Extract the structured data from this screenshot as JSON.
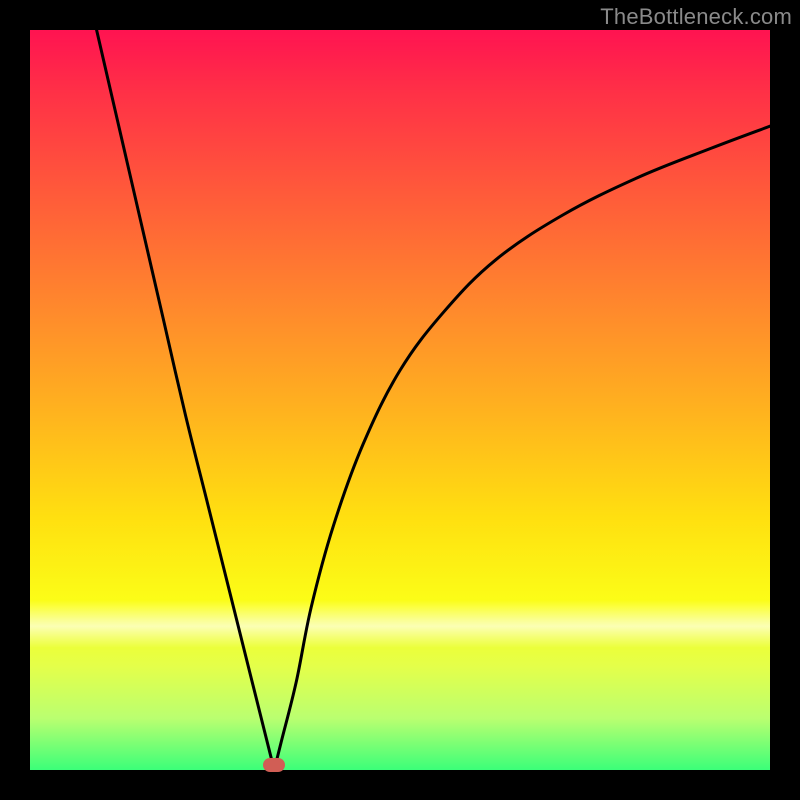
{
  "watermark": "TheBottleneck.com",
  "colors": {
    "frame": "#000000",
    "marker": "#d15e55",
    "curve": "#000000"
  },
  "chart_data": {
    "type": "line",
    "title": "",
    "xlabel": "",
    "ylabel": "",
    "xlim": [
      0,
      100
    ],
    "ylim": [
      0,
      100
    ],
    "grid": false,
    "legend": false,
    "min_marker": {
      "x": 33,
      "y": 0
    },
    "series": [
      {
        "name": "left-branch",
        "x": [
          9,
          12,
          15,
          18,
          21,
          24,
          27,
          30,
          32,
          33
        ],
        "y": [
          100,
          87,
          74,
          61,
          48,
          36,
          24,
          12,
          4,
          0
        ]
      },
      {
        "name": "right-branch",
        "x": [
          33,
          34,
          36,
          38,
          41,
          45,
          50,
          56,
          63,
          72,
          82,
          92,
          100
        ],
        "y": [
          0,
          4,
          12,
          22,
          33,
          44,
          54,
          62,
          69,
          75,
          80,
          84,
          87
        ]
      }
    ],
    "gradient_stops": [
      {
        "pos": 0,
        "color": "#ff1351"
      },
      {
        "pos": 8,
        "color": "#ff2f47"
      },
      {
        "pos": 22,
        "color": "#ff5a3a"
      },
      {
        "pos": 38,
        "color": "#ff8a2c"
      },
      {
        "pos": 52,
        "color": "#ffb41e"
      },
      {
        "pos": 66,
        "color": "#ffe010"
      },
      {
        "pos": 78,
        "color": "#fbff18"
      },
      {
        "pos": 86,
        "color": "#e4ff4a"
      },
      {
        "pos": 93,
        "color": "#baff70"
      },
      {
        "pos": 100,
        "color": "#3bff79"
      }
    ]
  }
}
